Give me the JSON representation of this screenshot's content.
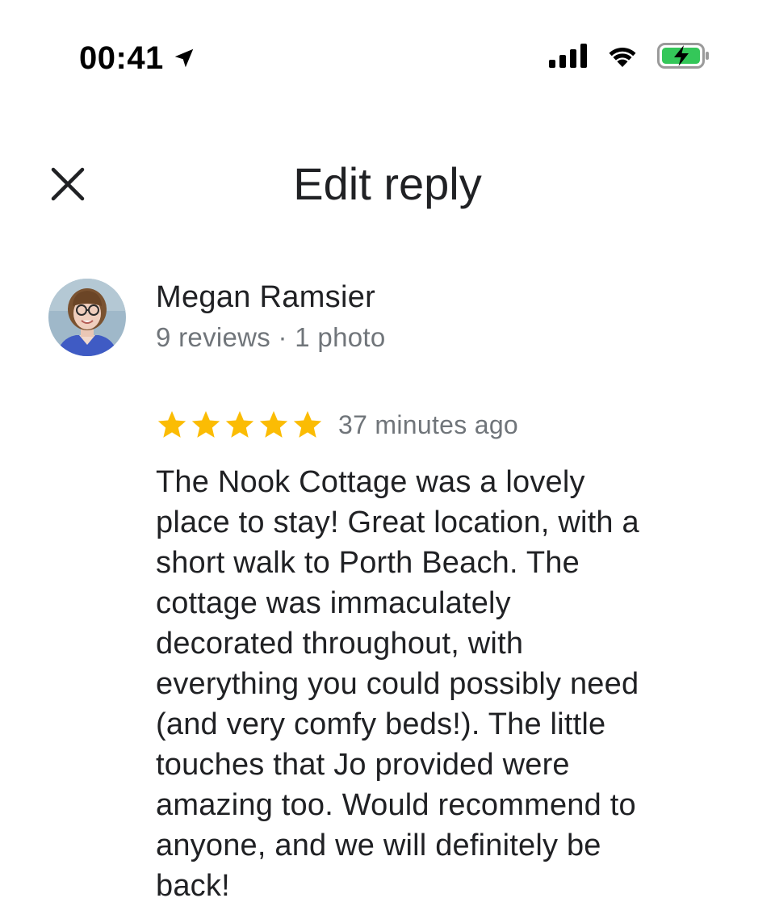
{
  "status_bar": {
    "time": "00:41",
    "battery_color": "#34c759",
    "icons": [
      "location-arrow-icon",
      "cellular-signal-icon",
      "wifi-icon",
      "battery-charging-icon"
    ]
  },
  "header": {
    "title": "Edit reply",
    "close_icon": "close-icon"
  },
  "reviewer": {
    "name": "Megan Ramsier",
    "meta": "9 reviews · 1 photo"
  },
  "review": {
    "rating": 5,
    "rating_max": 5,
    "star_color": "#fbbc04",
    "time_ago": "37 minutes ago",
    "text": "The Nook Cottage was a lovely\nplace to stay! Great location, with a\nshort walk to Porth Beach. The\ncottage was immaculately\ndecorated throughout, with\neverything you could possibly need\n(and very comfy beds!). The little\ntouches that Jo provided were\namazing too. Would recommend to\nanyone, and we will definitely be\nback!"
  }
}
